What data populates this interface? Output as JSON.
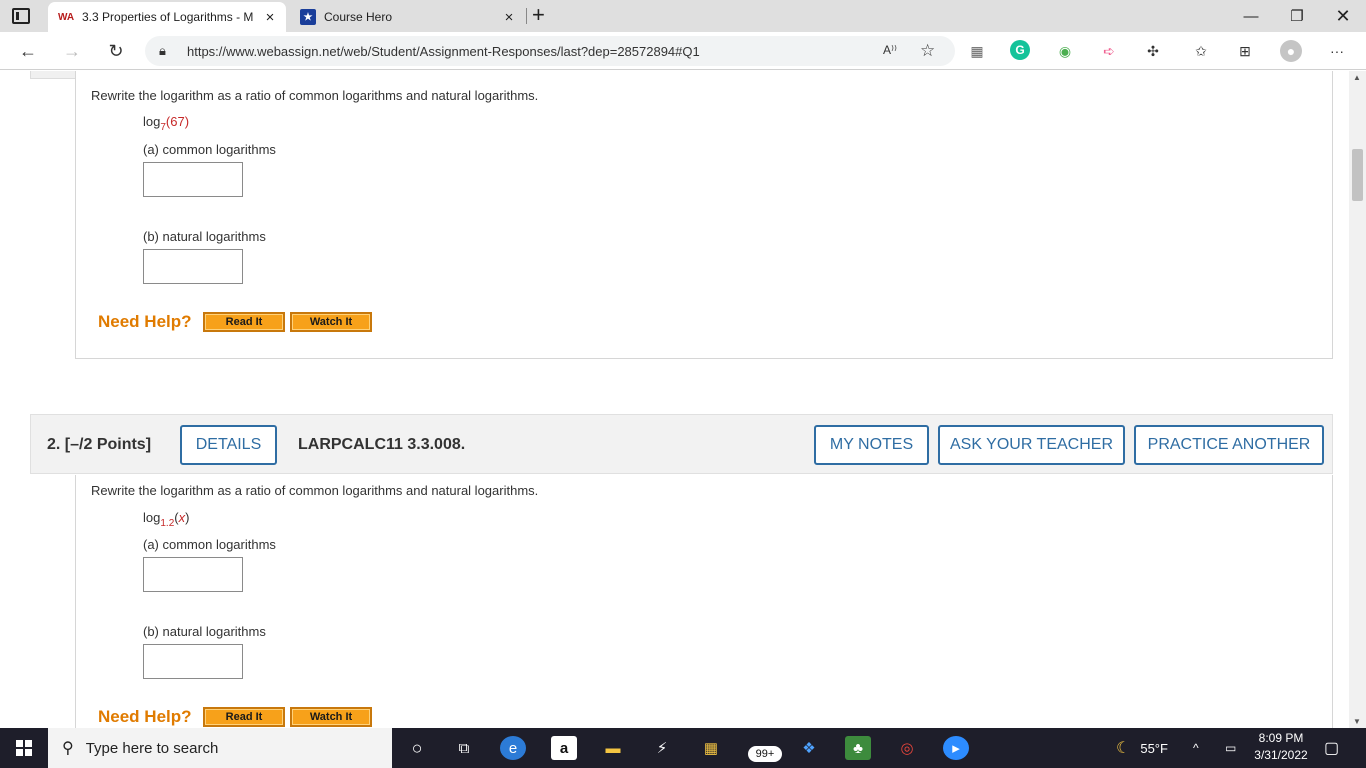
{
  "browser": {
    "tabs": [
      {
        "favicon": "WA",
        "label": "3.3 Properties of Logarithms - M",
        "close": "×"
      },
      {
        "favicon": "★",
        "label": "Course Hero",
        "close": "×"
      }
    ],
    "new_tab": "+",
    "url": "https://www.webassign.net/web/Student/Assignment-Responses/last?dep=28572894#Q1",
    "read_aloud": "A⁾⁾"
  },
  "question1": {
    "instruction": "Rewrite the logarithm as a ratio of common logarithms and natural logarithms.",
    "log_prefix": "log",
    "log_base": "7",
    "log_arg": "(67)",
    "part_a": "(a) common logarithms",
    "part_b": "(b) natural logarithms",
    "need_help": "Need Help?",
    "read_it": "Read It",
    "watch_it": "Watch It"
  },
  "question2": {
    "number": "2.",
    "points": "[–/2 Points]",
    "details": "DETAILS",
    "code": "LARPCALC11 3.3.008.",
    "my_notes": "MY NOTES",
    "ask_teacher": "ASK YOUR TEACHER",
    "practice": "PRACTICE ANOTHER",
    "instruction": "Rewrite the logarithm as a ratio of common logarithms and natural logarithms.",
    "log_prefix": "log",
    "log_base": "1.2",
    "log_arg_open": "(",
    "log_var": "x",
    "log_arg_close": ")",
    "part_a": "(a) common logarithms",
    "part_b": "(b) natural logarithms",
    "need_help": "Need Help?",
    "read_it": "Read It",
    "watch_it": "Watch It"
  },
  "taskbar": {
    "search_placeholder": "Type here to search",
    "badge": "99+",
    "weather": "55°F",
    "time": "8:09 PM",
    "date": "3/31/2022"
  },
  "colors": {
    "accent_blue": "#2f6da3",
    "help_orange": "#e07b00",
    "button_orange": "#f7a11a",
    "red_value": "#c62828"
  }
}
